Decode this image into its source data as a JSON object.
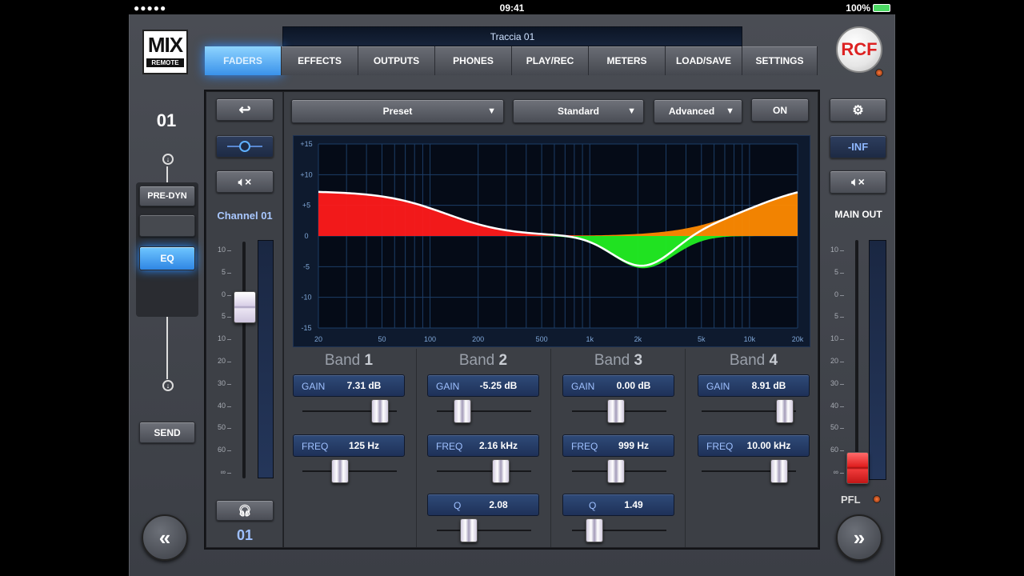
{
  "status": {
    "signal": "●●●●●",
    "time": "09:41",
    "battery": "100%"
  },
  "logo": {
    "title": "MIX",
    "subtitle": "REMOTE"
  },
  "brand": "RCF",
  "track_name": "Traccia 01",
  "tabs": [
    "FADERS",
    "EFFECTS",
    "OUTPUTS",
    "PHONES",
    "PLAY/REC",
    "METERS",
    "LOAD/SAVE",
    "SETTINGS"
  ],
  "active_tab": "FADERS",
  "left_strip": {
    "channel_number": "01",
    "pre_dyn": "PRE-DYN",
    "eq": "EQ",
    "send": "SEND"
  },
  "channel": {
    "name": "Channel 01",
    "number": "01",
    "fader_scale": [
      "10",
      "5",
      "0",
      "5",
      "10",
      "20",
      "30",
      "40",
      "50",
      "60",
      "∞"
    ],
    "fader_level_db": 0
  },
  "toolbar": {
    "preset": "Preset",
    "mode": "Standard",
    "advanced": "Advanced",
    "on": "ON"
  },
  "graph": {
    "y_ticks": [
      "+15",
      "+10",
      "+5",
      "0",
      "-5",
      "-10",
      "-15"
    ],
    "x_ticks": [
      "20",
      "50",
      "100",
      "200",
      "500",
      "1k",
      "2k",
      "5k",
      "10k",
      "20k"
    ],
    "colors": {
      "band1": "#ff1a1a",
      "band2": "#22ee22",
      "band4": "#ff8a00",
      "curve": "#ffffff",
      "grid": "#1c3d66"
    }
  },
  "bands": [
    {
      "title": "Band",
      "num": "1",
      "gain_label": "GAIN",
      "gain": "7.31 dB",
      "freq_label": "FREQ",
      "freq": "125 Hz",
      "gain_pos": 0.75,
      "freq_pos": 0.4
    },
    {
      "title": "Band",
      "num": "2",
      "gain_label": "GAIN",
      "gain": "-5.25 dB",
      "freq_label": "FREQ",
      "freq": "2.16 kHz",
      "q_label": "Q",
      "q": "2.08",
      "gain_pos": 0.32,
      "freq_pos": 0.68,
      "q_pos": 0.36
    },
    {
      "title": "Band",
      "num": "3",
      "gain_label": "GAIN",
      "gain": "0.00 dB",
      "freq_label": "FREQ",
      "freq": "999 Hz",
      "q_label": "Q",
      "q": "1.49",
      "gain_pos": 0.5,
      "freq_pos": 0.5,
      "q_pos": 0.27
    },
    {
      "title": "Band",
      "num": "4",
      "gain_label": "GAIN",
      "gain": "8.91 dB",
      "freq_label": "FREQ",
      "freq": "10.00 kHz",
      "gain_pos": 0.8,
      "freq_pos": 0.78
    }
  ],
  "right_strip": {
    "level": "-INF",
    "main_out": "MAIN OUT",
    "pfl": "PFL",
    "fader_scale": [
      "10",
      "5",
      "0",
      "5",
      "10",
      "20",
      "30",
      "40",
      "50",
      "60",
      "∞"
    ]
  }
}
